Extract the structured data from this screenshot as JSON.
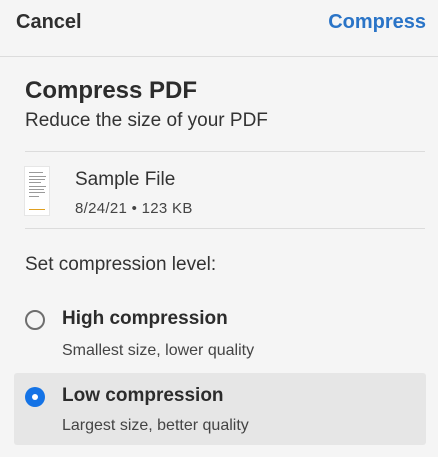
{
  "header": {
    "cancel_label": "Cancel",
    "compress_label": "Compress"
  },
  "page": {
    "title": "Compress PDF",
    "subtitle": "Reduce the size of your PDF"
  },
  "file": {
    "name": "Sample File",
    "meta": "8/24/21 • 123 KB",
    "thumbnail_icon": "pdf-thumbnail-icon"
  },
  "compression": {
    "label": "Set compression level:",
    "options": [
      {
        "title": "High compression",
        "description": "Smallest size, lower quality",
        "selected": false
      },
      {
        "title": "Low compression",
        "description": "Largest size, better quality",
        "selected": true
      }
    ]
  },
  "colors": {
    "accent": "#1473e6",
    "link": "#2a74c7",
    "selected_bg": "#e6e6e6",
    "background": "#f5f5f5"
  }
}
